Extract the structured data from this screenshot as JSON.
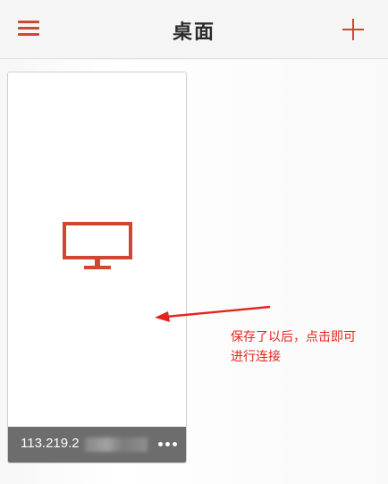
{
  "header": {
    "title": "桌面",
    "menu_icon": "hamburger-menu-icon",
    "add_icon": "plus-icon"
  },
  "desktop": {
    "ip_visible": "113.219.2",
    "more_icon": "ellipsis-icon",
    "monitor_icon": "monitor-icon"
  },
  "annotation": {
    "line1": "保存了以后，点击即可",
    "line2": "进行连接"
  },
  "colors": {
    "accent": "#d1462f",
    "annotation": "#e3261d",
    "footer": "#6d6d6d"
  }
}
